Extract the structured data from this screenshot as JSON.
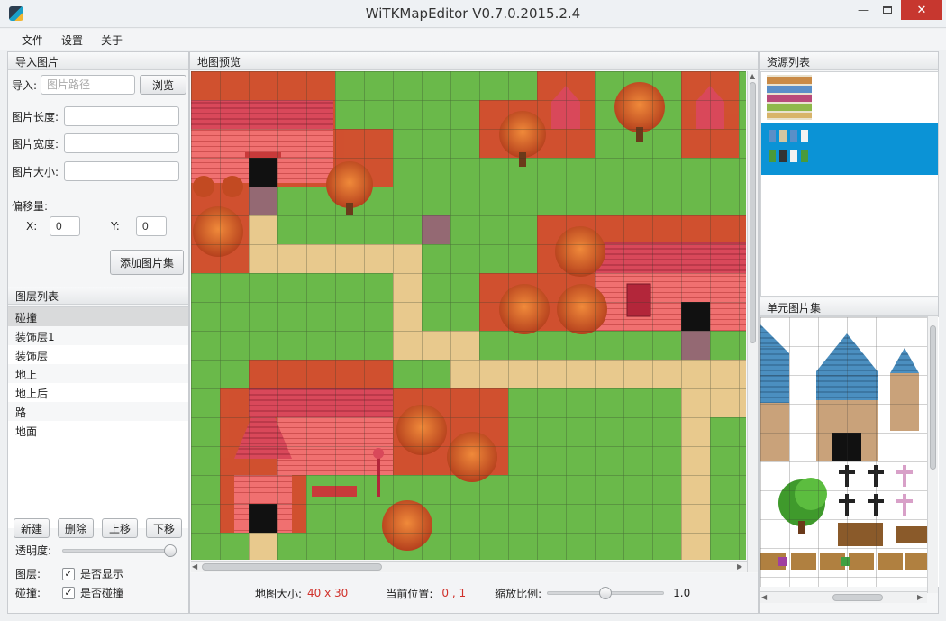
{
  "window": {
    "title": "WiTKMapEditor V0.7.0.2015.2.4",
    "minimize": "—",
    "close": "✕"
  },
  "menu": [
    "文件",
    "设置",
    "关于"
  ],
  "import_panel": {
    "header": "导入图片",
    "import_label": "导入:",
    "path_placeholder": "图片路径",
    "browse": "浏览",
    "length_label": "图片长度:",
    "width_label": "图片宽度:",
    "size_label": "图片大小:",
    "offset_label": "偏移量:",
    "x_label": "X:",
    "x_value": "0",
    "y_label": "Y:",
    "y_value": "0",
    "add_button": "添加图片集"
  },
  "layer_panel": {
    "header": "图层列表",
    "layers": [
      "碰撞",
      "装饰层1",
      "装饰层",
      "地上",
      "地上后",
      "路",
      "地面"
    ],
    "selected_index": 0,
    "buttons": {
      "new": "新建",
      "delete": "删除",
      "up": "上移",
      "down": "下移"
    },
    "opacity_label": "透明度:",
    "opacity_value": 1.0,
    "layer_label": "图层:",
    "show_label": "是否显示",
    "collision_label": "碰撞:",
    "collide_label": "是否碰撞"
  },
  "map_panel": {
    "header": "地图预览",
    "size_label": "地图大小:",
    "size_value": "40 x 30",
    "position_label": "当前位置:",
    "position_value": "0 , 1",
    "zoom_label": "缩放比例:",
    "zoom_value": "1.0"
  },
  "resource_panel": {
    "header": "资源列表",
    "selected_index": 1
  },
  "tileset_panel": {
    "header": "单元图片集"
  },
  "colors": {
    "grass": "#6ab94a",
    "path": "#e8c98d",
    "collision": "#d9482d",
    "roof": "#d94a5c",
    "selection": "#0b93d6",
    "status_value": "#d0302a"
  }
}
